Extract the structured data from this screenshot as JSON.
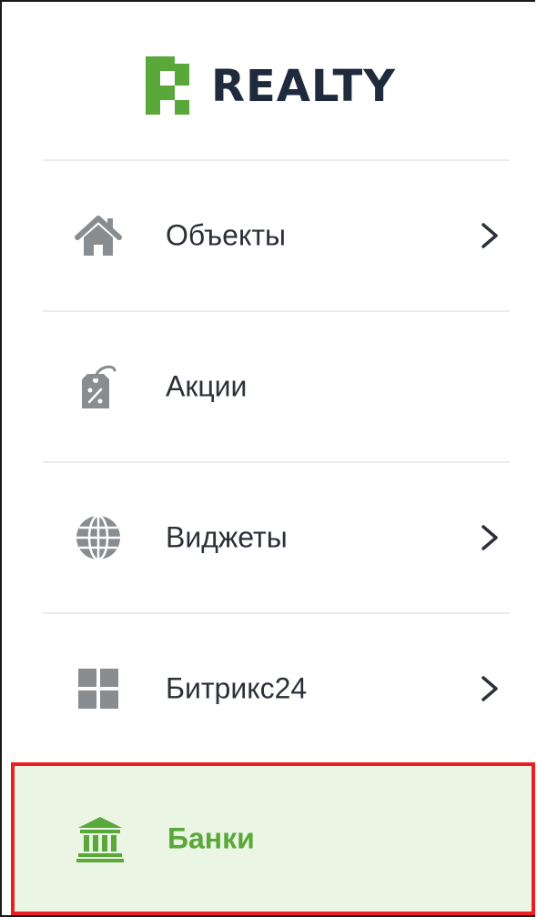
{
  "brand": {
    "name": "REALTY",
    "accent_color": "#5aa83a",
    "text_color": "#1f2a3d"
  },
  "menu": {
    "items": [
      {
        "label": "Объекты",
        "icon": "home-icon",
        "has_submenu": true,
        "active": false
      },
      {
        "label": "Акции",
        "icon": "price-tag-icon",
        "has_submenu": false,
        "active": false
      },
      {
        "label": "Виджеты",
        "icon": "globe-icon",
        "has_submenu": true,
        "active": false
      },
      {
        "label": "Битрикс24",
        "icon": "grid-icon",
        "has_submenu": true,
        "active": false
      },
      {
        "label": "Банки",
        "icon": "bank-icon",
        "has_submenu": false,
        "active": true
      }
    ],
    "highlight_color": "#ee1c24",
    "active_background": "#eaf5e4"
  }
}
